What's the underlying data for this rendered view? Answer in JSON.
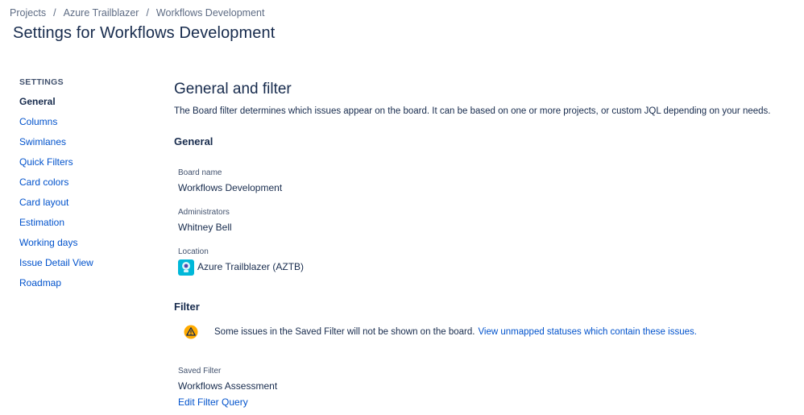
{
  "breadcrumb": {
    "items": [
      "Projects",
      "Azure Trailblazer",
      "Workflows Development"
    ],
    "separator": "/"
  },
  "page_title": "Settings for Workflows Development",
  "sidebar": {
    "heading": "SETTINGS",
    "items": [
      {
        "label": "General",
        "active": true
      },
      {
        "label": "Columns"
      },
      {
        "label": "Swimlanes"
      },
      {
        "label": "Quick Filters"
      },
      {
        "label": "Card colors"
      },
      {
        "label": "Card layout"
      },
      {
        "label": "Estimation"
      },
      {
        "label": "Working days"
      },
      {
        "label": "Issue Detail View"
      },
      {
        "label": "Roadmap"
      }
    ]
  },
  "main": {
    "title": "General and filter",
    "description": "The Board filter determines which issues appear on the board. It can be based on one or more projects, or custom JQL depending on your needs.",
    "general": {
      "heading": "General",
      "board_name_label": "Board name",
      "board_name": "Workflows Development",
      "administrators_label": "Administrators",
      "administrators": "Whitney Bell",
      "location_label": "Location",
      "location": "Azure Trailblazer (AZTB)",
      "location_icon": "project-avatar-icon"
    },
    "filter": {
      "heading": "Filter",
      "warning_icon": "warning-icon",
      "warning_text": "Some issues in the Saved Filter will not be shown on the board.",
      "warning_link": "View unmapped statuses which contain these issues.",
      "saved_filter_label": "Saved Filter",
      "saved_filter": "Workflows Assessment",
      "edit_link": "Edit Filter Query"
    }
  },
  "colors": {
    "link": "#0052cc",
    "text": "#172b4d",
    "subtle": "#5e6c84",
    "project_icon": "#00b8d9",
    "warning": "#ffab00"
  }
}
